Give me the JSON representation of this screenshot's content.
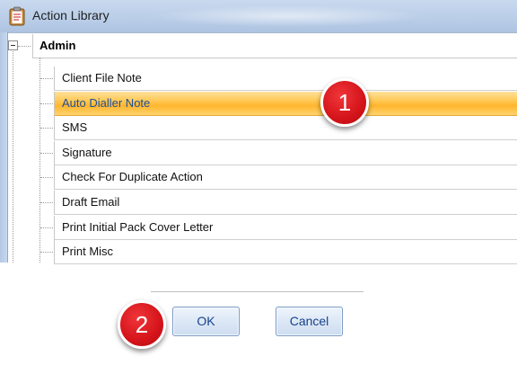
{
  "window": {
    "title": "Action Library",
    "icon": "clipboard-icon"
  },
  "tree": {
    "root": {
      "label": "Admin",
      "expanded": true,
      "expander_icon": "minus-box-icon"
    },
    "items": [
      {
        "label": "Client File Note",
        "selected": false
      },
      {
        "label": "Auto Dialler Note",
        "selected": true
      },
      {
        "label": "SMS",
        "selected": false
      },
      {
        "label": "Signature",
        "selected": false
      },
      {
        "label": "Check For Duplicate Action",
        "selected": false
      },
      {
        "label": "Draft Email",
        "selected": false
      },
      {
        "label": "Print Initial Pack Cover Letter",
        "selected": false
      },
      {
        "label": "Print Misc",
        "selected": false
      }
    ]
  },
  "callouts": [
    {
      "number": "1"
    },
    {
      "number": "2"
    }
  ],
  "buttons": {
    "ok_label": "OK",
    "cancel_label": "Cancel"
  },
  "colors": {
    "selection": "#ffc14a",
    "selected_text": "#1f4f9a",
    "callout": "#d4141a",
    "button_text": "#15428b"
  }
}
